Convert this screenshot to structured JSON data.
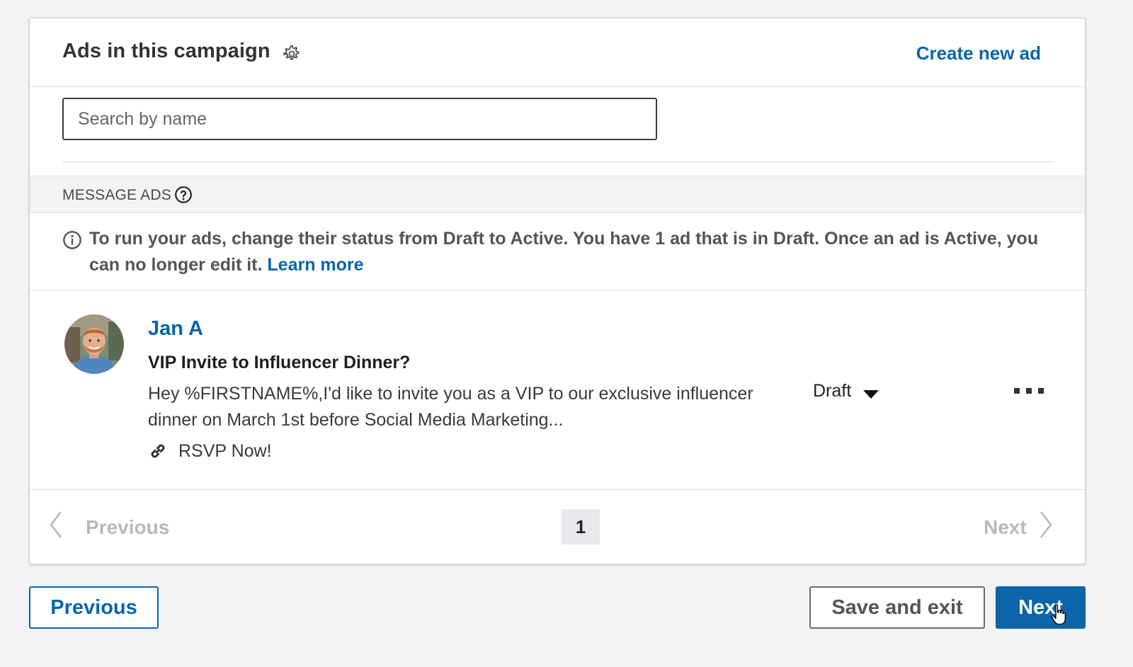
{
  "campaign_ads": {
    "title": "Ads in this campaign",
    "create_label": "Create new ad",
    "search": {
      "placeholder": "Search by name",
      "value": ""
    },
    "section_label": "MESSAGE ADS",
    "info": {
      "text": "To run your ads, change their status from Draft to Active. You have 1 ad that is in Draft. Once an ad is Active, you can no longer edit it. ",
      "link": "Learn more"
    },
    "ads": [
      {
        "sender": "Jan A",
        "subject": "VIP Invite to Influencer Dinner?",
        "body": "Hey %FIRSTNAME%,I'd like to invite you as a VIP to our exclusive influencer dinner on March 1st before Social Media Marketing...",
        "cta": "RSVP Now!",
        "status": "Draft"
      }
    ],
    "pagination": {
      "previous_label": "Previous",
      "current_page": "1",
      "next_label": "Next"
    }
  },
  "footer": {
    "previous_label": "Previous",
    "save_label": "Save and exit",
    "next_label": "Next"
  },
  "colors": {
    "accent": "#0a66a8",
    "background": "#f3f3f5",
    "disabled_text": "#b9b9bd"
  },
  "icons": [
    "gear-icon",
    "help-circle-icon",
    "info-circle-icon",
    "avatar",
    "link-icon",
    "caret-down-icon",
    "more-icon",
    "chevron-left-icon",
    "chevron-right-icon",
    "hand-cursor-icon"
  ]
}
